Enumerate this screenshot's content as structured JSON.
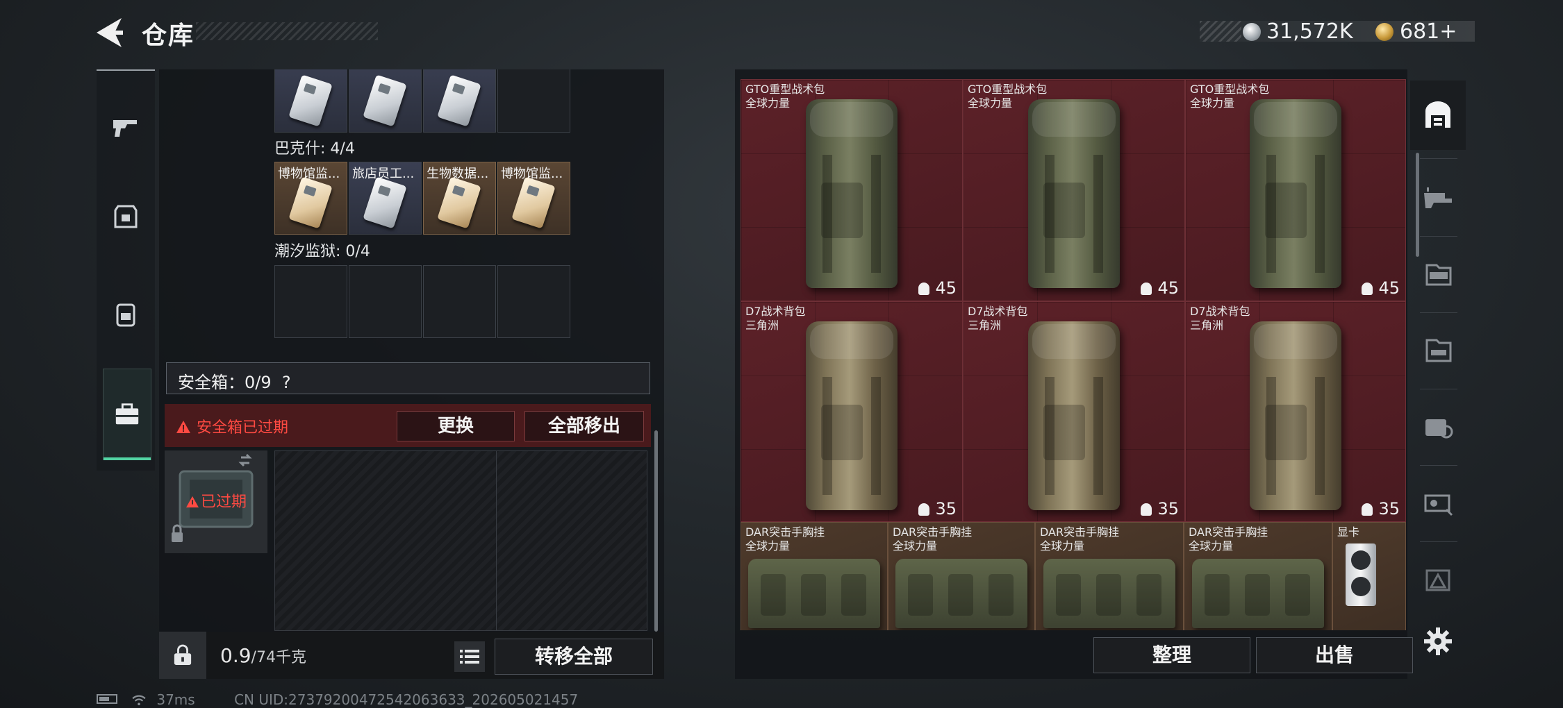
{
  "header": {
    "title": "仓库",
    "currency1": "31,572K",
    "currency2": "681+"
  },
  "left_tabs": [
    "gun-icon",
    "armor-icon",
    "backpack-icon",
    "briefcase-icon"
  ],
  "left_panel": {
    "top_row_cells": 3,
    "section1": "巴克什: 4/4",
    "section1_items": [
      "博物馆监...",
      "旅店员工...",
      "生物数据...",
      "博物馆监..."
    ],
    "section2": "潮汐监狱: 0/4",
    "safebox_label": "安全箱：0/9",
    "safebox_help": "?",
    "expired_warning": "安全箱已过期",
    "replace_button": "更换",
    "move_all_out_button": "全部移出",
    "case_status": "已过期",
    "weight_value": "0.9",
    "weight_max": "/74千克",
    "transfer_all_button": "转移全部"
  },
  "stash": {
    "rows": [
      [
        {
          "name": "GTO重型战术包",
          "brand": "全球力量",
          "capacity": "45"
        },
        {
          "name": "GTO重型战术包",
          "brand": "全球力量",
          "capacity": "45"
        },
        {
          "name": "GTO重型战术包",
          "brand": "全球力量",
          "capacity": "45"
        }
      ],
      [
        {
          "name": "D7战术背包",
          "brand": "三角洲",
          "capacity": "35"
        },
        {
          "name": "D7战术背包",
          "brand": "三角洲",
          "capacity": "35"
        },
        {
          "name": "D7战术背包",
          "brand": "三角洲",
          "capacity": "35"
        }
      ],
      [
        {
          "name": "DAR突击手胸挂",
          "brand": "全球力量"
        },
        {
          "name": "DAR突击手胸挂",
          "brand": "全球力量"
        },
        {
          "name": "DAR突击手胸挂",
          "brand": "全球力量"
        },
        {
          "name": "DAR突击手胸挂",
          "brand": "全球力量"
        },
        {
          "name": "显卡",
          "brand": ""
        }
      ]
    ],
    "sort_button": "整理",
    "sell_button": "出售"
  },
  "status": {
    "ping": "37ms",
    "uid": "CN UID:273792004725420636​33_202605021457"
  },
  "colors": {
    "accent": "#52d4a3",
    "alert": "#ff4a42",
    "stash_cell": "#5c2128"
  }
}
